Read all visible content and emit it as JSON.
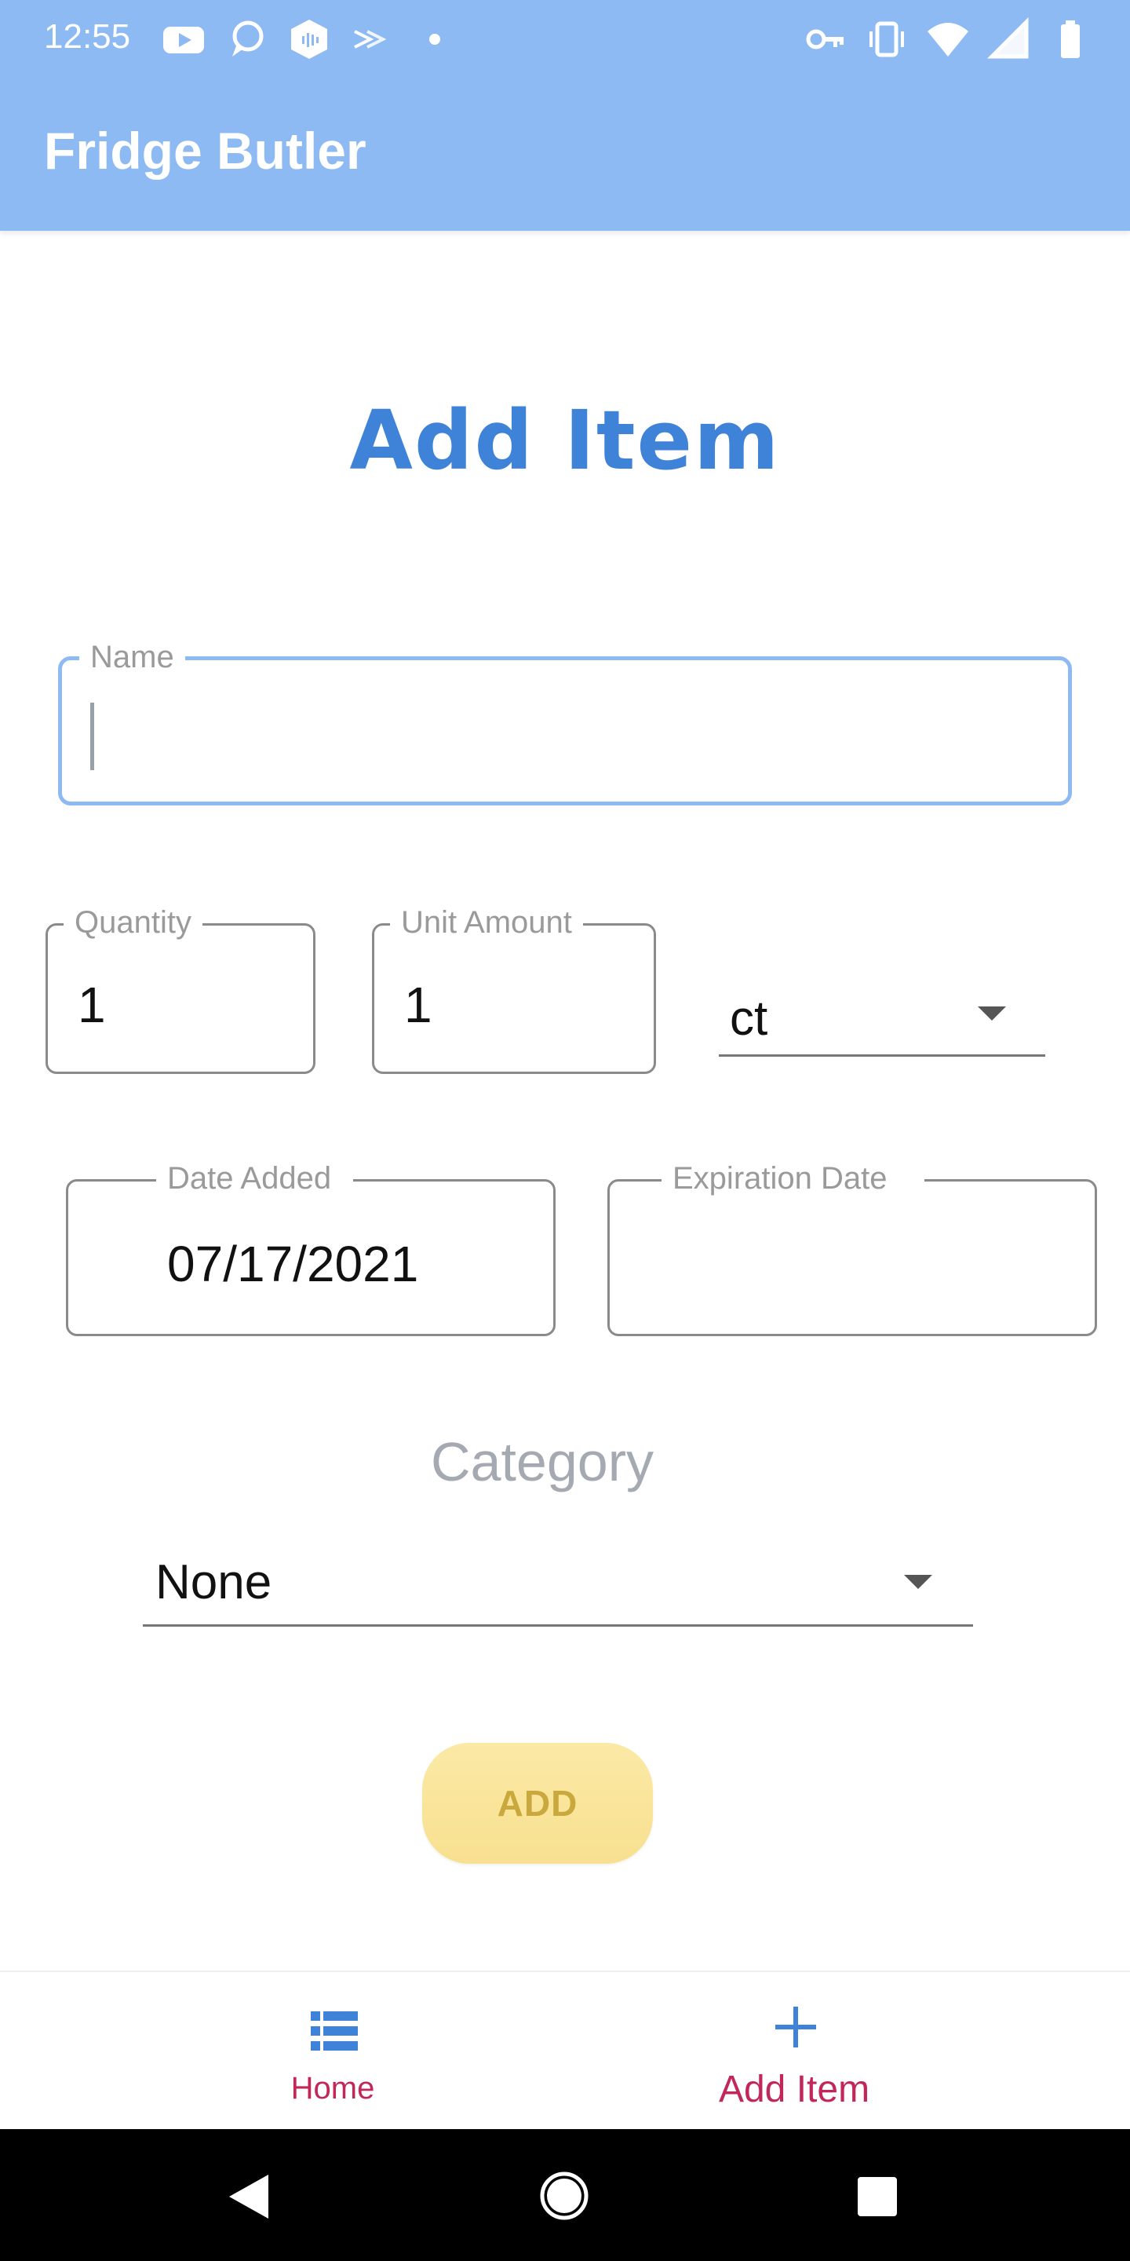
{
  "status_bar": {
    "time": "12:55",
    "icons_left": [
      "youtube-icon",
      "chat-bubble-icon",
      "shield-icon",
      "cast-icon",
      "dot-icon"
    ],
    "icons_right": [
      "vpn-key-icon",
      "vibrate-icon",
      "wifi-icon",
      "signal-icon",
      "battery-icon"
    ]
  },
  "app_bar": {
    "title": "Fridge Butler"
  },
  "page": {
    "heading": "Add Item"
  },
  "form": {
    "name": {
      "label": "Name",
      "value": ""
    },
    "quantity": {
      "label": "Quantity",
      "value": "1"
    },
    "unit_amount": {
      "label": "Unit Amount",
      "value": "1"
    },
    "unit": {
      "selected": "ct"
    },
    "date_added": {
      "label": "Date Added",
      "value": "07/17/2021"
    },
    "expiration_date": {
      "label": "Expiration Date",
      "value": ""
    },
    "category": {
      "label": "Category",
      "selected": "None"
    },
    "submit_label": "ADD"
  },
  "bottom_nav": {
    "items": [
      {
        "label": "Home",
        "icon": "list-icon"
      },
      {
        "label": "Add Item",
        "icon": "plus-icon"
      }
    ]
  },
  "colors": {
    "app_bar": "#8dbaf2",
    "heading": "#3f83d8",
    "nav_label": "#c2275a",
    "button_bg": "#f8e08f",
    "button_text": "#c9a83d"
  }
}
